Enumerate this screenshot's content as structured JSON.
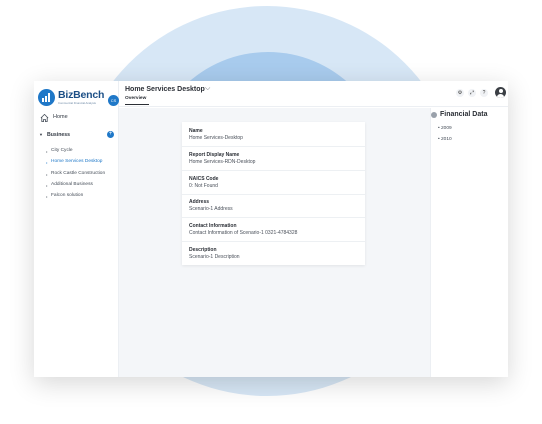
{
  "sidebar": {
    "logo_text": "BizBench",
    "logo_tagline": "Commercial Financial Analysis",
    "logo_badge": "CS",
    "home_label": "Home",
    "business_label": "Business",
    "items": [
      {
        "label": "City Cycle",
        "active": false
      },
      {
        "label": "Home Services Desktop",
        "active": true
      },
      {
        "label": "Rock Castle Construction",
        "active": false
      },
      {
        "label": "Additional Business",
        "active": false
      },
      {
        "label": "Falcon solution",
        "active": false
      }
    ]
  },
  "header": {
    "title": "Home Services Desktop",
    "tab": "Overview",
    "icons": [
      "gear-icon",
      "expand-icon",
      "help-icon",
      "user-avatar"
    ]
  },
  "card": {
    "name_label": "Name",
    "name_value": "Home Services-Desktop",
    "display_label": "Report Display Name",
    "display_value": "Home Services-RDN-Desktop",
    "naics_label": "NAICS Code",
    "naics_value": "0: Not Found",
    "address_label": "Address",
    "address_value": "Scenario-1 Address",
    "contact_label": "Contact Information",
    "contact_value": "Contact Information of Scenario-1  0321-4784328",
    "description_label": "Description",
    "description_value": "Scenario-1 Description"
  },
  "financial": {
    "title": "Financial Data",
    "years": [
      "2009",
      "2010"
    ]
  },
  "colors": {
    "accent": "#1f78c8",
    "main_bg": "#f4f6f9",
    "circle_outer": "#d7e7f6",
    "circle_inner": "#a8cbed"
  }
}
